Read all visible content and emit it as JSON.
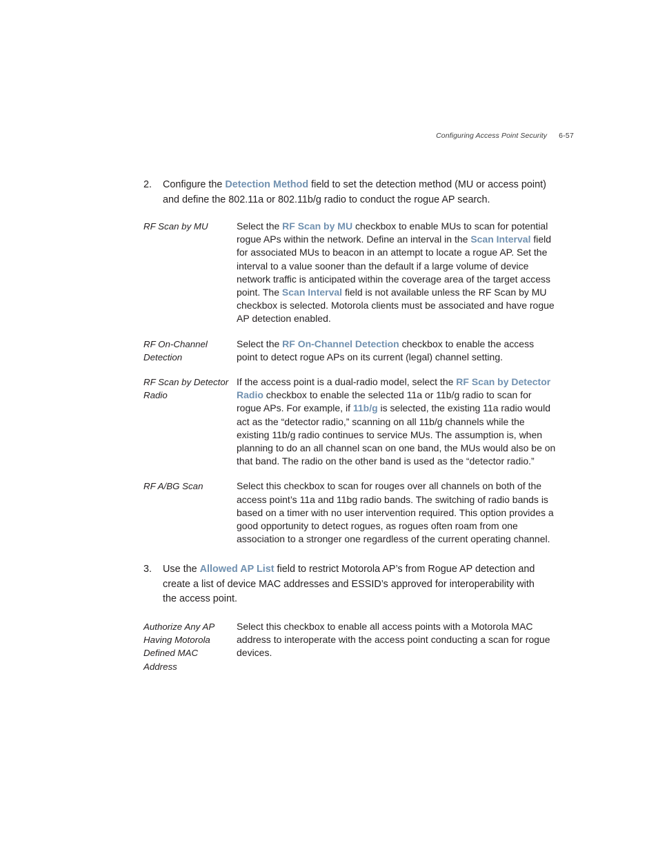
{
  "header": {
    "title": "Configuring Access Point Security",
    "page_number": "6-57"
  },
  "accent_color": "#7191b0",
  "text_color": "#231f20",
  "steps": [
    {
      "number": "2.",
      "text_before": "Configure the ",
      "ui_term": "Detection Method",
      "text_after": " field to set the detection method (MU or access point) and define the 802.11a or 802.11b/g radio to conduct the rogue AP search."
    },
    {
      "number": "3.",
      "text_before": "Use the ",
      "ui_term": "Allowed AP List",
      "text_after": " field to restrict Motorola AP’s from Rogue AP detection and create a list of device MAC addresses and ESSID’s approved for interoperability with the access point."
    }
  ],
  "definitions_step2": [
    {
      "term": "RF Scan by MU",
      "parts": [
        {
          "type": "plain",
          "text": "Select the "
        },
        {
          "type": "ui",
          "text": "RF Scan by MU"
        },
        {
          "type": "plain",
          "text": " checkbox to enable MUs to scan for potential rogue APs within the network. Define an interval in the "
        },
        {
          "type": "ui",
          "text": "Scan Interval"
        },
        {
          "type": "plain",
          "text": " field for associated MUs to beacon in an attempt to locate a rogue AP. Set the interval to a value sooner than the default if a large volume of device network traffic is anticipated within the coverage area of the target access point. The "
        },
        {
          "type": "ui",
          "text": "Scan Interval"
        },
        {
          "type": "plain",
          "text": " field is not available unless the RF Scan by MU checkbox is selected. Motorola clients must be associated and have rogue AP detection enabled."
        }
      ]
    },
    {
      "term": "RF On-Channel Detection",
      "parts": [
        {
          "type": "plain",
          "text": "Select the "
        },
        {
          "type": "ui",
          "text": "RF On-Channel Detection"
        },
        {
          "type": "plain",
          "text": " checkbox to enable the access point to detect rogue APs on its current (legal) channel setting."
        }
      ]
    },
    {
      "term": "RF Scan by Detector Radio",
      "parts": [
        {
          "type": "plain",
          "text": "If the access point is a dual-radio model, select the "
        },
        {
          "type": "ui",
          "text": "RF Scan by Detector Radio"
        },
        {
          "type": "plain",
          "text": " checkbox to enable the selected 11a or 11b/g radio to scan for rogue APs. For example, if "
        },
        {
          "type": "ui",
          "text": "11b/g"
        },
        {
          "type": "plain",
          "text": " is selected, the existing 11a radio would act as the “detector radio,” scanning on all 11b/g channels while the existing 11b/g radio continues to service MUs. The assumption is, when planning to do an all channel scan on one band, the MUs would also be on that band. The radio on the other band is used as the “detector radio.”"
        }
      ]
    },
    {
      "term": "RF A/BG Scan",
      "parts": [
        {
          "type": "plain",
          "text": "Select this checkbox to scan for rouges over all channels on both of the access point’s 11a and 11bg radio bands. The switching of radio bands is based on a timer with no user intervention required. This option provides a good opportunity to detect rogues, as rogues often roam from one association to a stronger one regardless of the current operating channel."
        }
      ]
    }
  ],
  "definitions_step3": [
    {
      "term": "Authorize Any AP Having Motorola Defined MAC Address",
      "parts": [
        {
          "type": "plain",
          "text": "Select this checkbox to enable all access points with a Motorola MAC address to interoperate with the access point conducting a scan for rogue devices."
        }
      ]
    }
  ]
}
